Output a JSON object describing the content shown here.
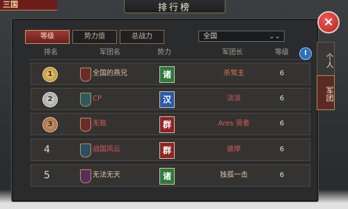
{
  "title": "排行榜",
  "logo_text": "三国",
  "side_tabs": [
    "个人",
    "军团"
  ],
  "filters": [
    "等级",
    "势力值",
    "总战力"
  ],
  "dropdown": {
    "value": "全国"
  },
  "columns": [
    "排名",
    "军团名",
    "势力",
    "军团长",
    "等级"
  ],
  "rows": [
    {
      "rank": "1",
      "name": "全国的燕兄",
      "name_color": "#d8c7a6",
      "power": "诸",
      "power_bg": "#2e7a3c",
      "leader": "杀驾主",
      "leader_color": "#e07a5a",
      "level": "6",
      "emblem": "#6a2c26"
    },
    {
      "rank": "2",
      "name": "CP",
      "name_color": "#d65a5a",
      "power": "汉",
      "power_bg": "#2c5aa8",
      "leader": "淡淡",
      "leader_color": "#d65a5a",
      "level": "6",
      "emblem": "#2b5b5a"
    },
    {
      "rank": "3",
      "name": "无极",
      "name_color": "#d65a5a",
      "power": "群",
      "power_bg": "#8e2424",
      "leader": "Ares 贤者",
      "leader_color": "#d65a5a",
      "level": "6",
      "emblem": "#6a2c26"
    },
    {
      "rank": "4",
      "name": "战国风云",
      "name_color": "#d65a5a",
      "power": "群",
      "power_bg": "#8e2424",
      "leader": "彼岸",
      "leader_color": "#d65a5a",
      "level": "6",
      "emblem": "#2b4f5e"
    },
    {
      "rank": "5",
      "name": "无法无天",
      "name_color": "#d8c7a6",
      "power": "诸",
      "power_bg": "#2e7a3c",
      "leader": "独孤一击",
      "leader_color": "#d8c7a6",
      "level": "6",
      "emblem": "#5a2d57"
    }
  ],
  "colors": {
    "accent": "#9c3a33",
    "panel": "#2a2b2d"
  }
}
